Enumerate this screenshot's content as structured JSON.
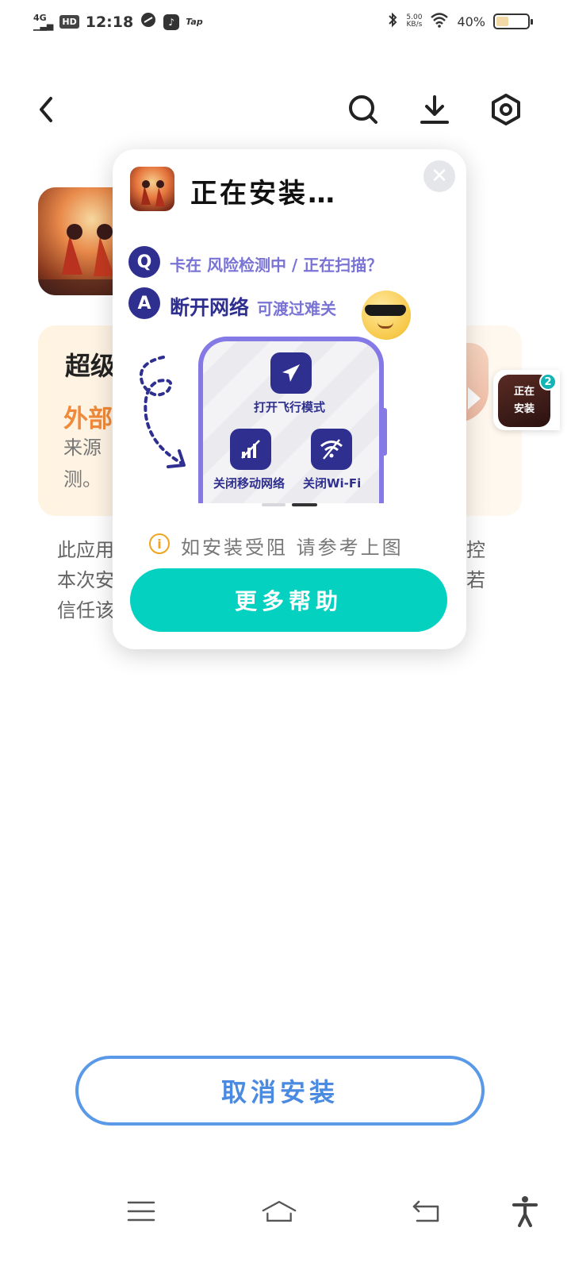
{
  "status_bar": {
    "network": "4G",
    "hd": "HD",
    "time": "12:18",
    "tap_label": "Tap",
    "speed_value": "5.00",
    "speed_unit": "KB/s",
    "battery": "40%",
    "battery_level": 0.4
  },
  "header": {
    "back_icon": "chevron-left-icon",
    "search_icon": "search-icon",
    "download_icon": "download-icon",
    "settings_icon": "gear-icon"
  },
  "background": {
    "warning_title": "超级",
    "warning_subtitle": "外部",
    "warning_text_line1": "来源",
    "warning_text_line2": "测。",
    "desc_line1": "此应用",
    "desc_line2": "本次安",
    "desc_line3": "信任该",
    "desc_right_line1": "控",
    "desc_right_line2": "若"
  },
  "floating_bubble": {
    "label_line1": "正在",
    "label_line2": "安装",
    "badge": "2"
  },
  "dialog": {
    "title": "正在安装…",
    "q_badge": "Q",
    "question": "卡在 风险检测中 / 正在扫描？",
    "a_badge": "A",
    "answer_main": "断开网络",
    "answer_sub": "可渡过难关",
    "tiles": {
      "airplane": "打开飞行模式",
      "mobile": "关闭移动网络",
      "wifi": "关闭Wi-Fi"
    },
    "hint": "如安装受阻 请参考上图",
    "more_help": "更多帮助"
  },
  "cancel_button": "取消安装",
  "colors": {
    "accent_teal": "#05d1c1",
    "accent_blue": "#4a8ae0",
    "navy": "#2e2f8f",
    "purple": "#8579e6",
    "warning_orange": "#f08a3a"
  }
}
